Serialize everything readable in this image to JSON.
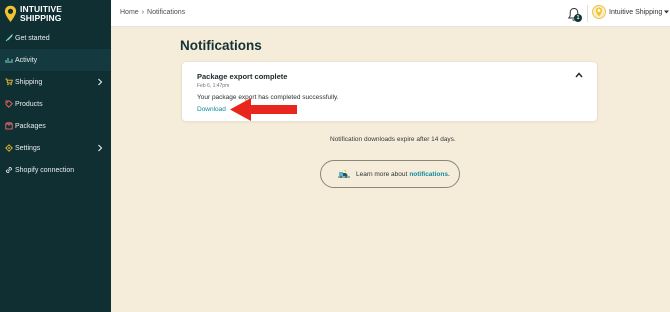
{
  "brand": {
    "line1": "INTUITIVE",
    "line2": "SHIPPING"
  },
  "sidebar": {
    "items": [
      {
        "label": "Get started",
        "icon": "rocket-icon",
        "active": false,
        "chevron": false
      },
      {
        "label": "Activity",
        "icon": "activity-chart-icon",
        "active": true,
        "chevron": false
      },
      {
        "label": "Shipping",
        "icon": "cart-icon",
        "active": false,
        "chevron": true
      },
      {
        "label": "Products",
        "icon": "tag-icon",
        "active": false,
        "chevron": false
      },
      {
        "label": "Packages",
        "icon": "box-icon",
        "active": false,
        "chevron": false
      },
      {
        "label": "Settings",
        "icon": "gear-icon",
        "active": false,
        "chevron": true
      },
      {
        "label": "Shopify connection",
        "icon": "link-icon",
        "active": false,
        "chevron": false
      }
    ]
  },
  "topbar": {
    "breadcrumb": {
      "home": "Home",
      "separator": "›",
      "current": "Notifications"
    },
    "notification_count": "1",
    "account_name": "Intuitive Shipping"
  },
  "main": {
    "title": "Notifications",
    "notification": {
      "title": "Package export complete",
      "date": "Feb 6, 1:47pm",
      "body": "Your package export has completed successfully.",
      "link": "Download"
    },
    "expire_note": "Notification downloads expire after 14 days.",
    "learn_more": {
      "prefix": "Learn more about",
      "link": "notifications."
    }
  },
  "colors": {
    "sidebar_bg": "#0f2f33",
    "page_bg": "#f6ecda",
    "accent": "#0f8aa0",
    "brand_yellow": "#f2c230",
    "annotation_red": "#e8261e"
  }
}
